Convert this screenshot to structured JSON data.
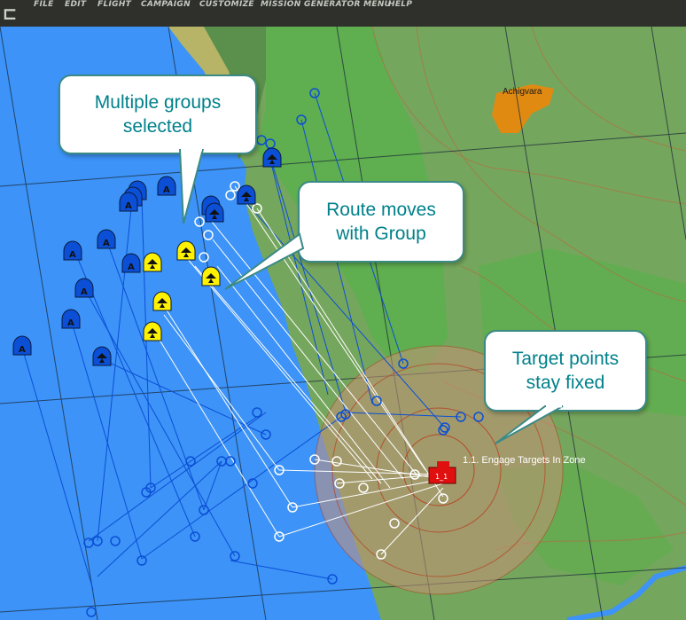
{
  "menu": {
    "items": [
      "FILE",
      "EDIT",
      "FLIGHT",
      "CAMPAIGN",
      "CUSTOMIZE",
      "MISSION GENERATOR MENU",
      "HELP"
    ]
  },
  "map": {
    "town_label": "Achigvara",
    "waypoint_label": "1.1. Engage Targets In Zone",
    "target_marker_label": "1_1"
  },
  "callouts": {
    "groups": "Multiple groups\nselected",
    "route": "Route moves\nwith Group",
    "target": "Target points\nstay fixed"
  },
  "colors": {
    "sea": "#3d93f7",
    "land": "#75a65d",
    "forest": "#5fae4f",
    "callout_text": "#00808a",
    "blue_unit": "#0b4fd6",
    "selected_unit": "#fff200",
    "target": "#e01010"
  }
}
